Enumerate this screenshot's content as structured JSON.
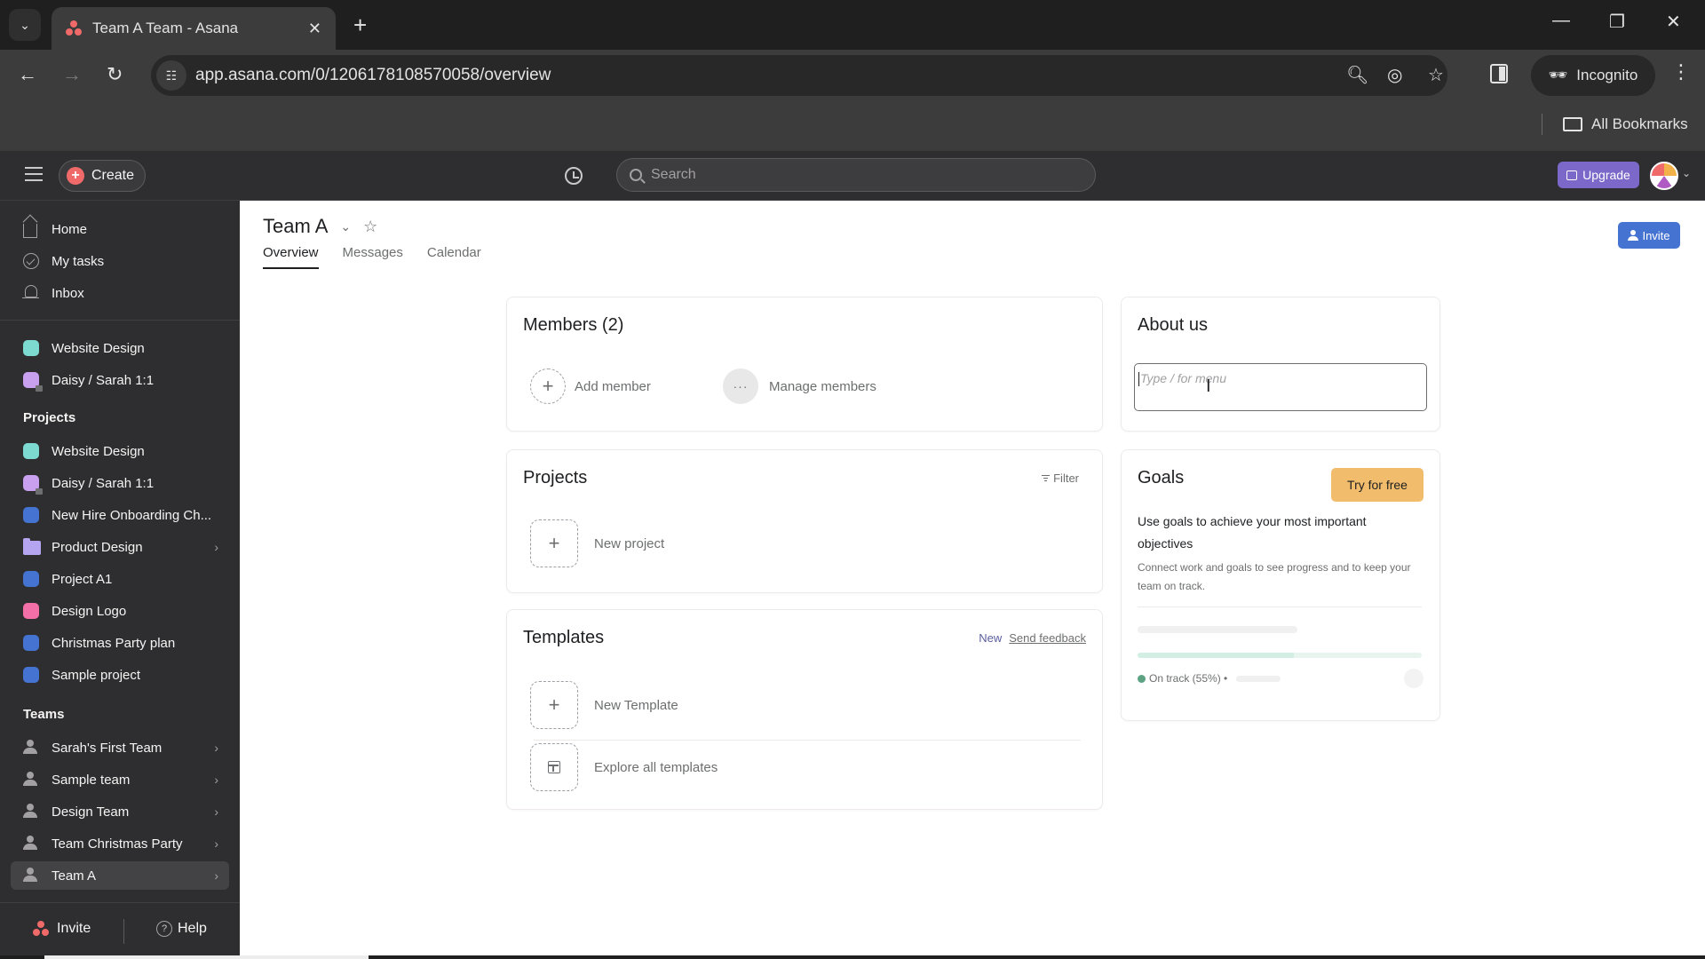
{
  "browser": {
    "tab_title": "Team A Team - Asana",
    "url": "app.asana.com/0/1206178108570058/overview",
    "incognito_label": "Incognito",
    "bookmarks_label": "All Bookmarks"
  },
  "topbar": {
    "create_label": "Create",
    "search_placeholder": "Search",
    "upgrade_label": "Upgrade"
  },
  "sidebar": {
    "nav": [
      {
        "label": "Home",
        "icon": "home-icon"
      },
      {
        "label": "My tasks",
        "icon": "check-circle-icon"
      },
      {
        "label": "Inbox",
        "icon": "bell-icon"
      }
    ],
    "favorites": [
      {
        "label": "Website Design",
        "color": "#7ddad0"
      },
      {
        "label": "Daisy / Sarah 1:1",
        "color": "#c9a0f0",
        "locked": true
      }
    ],
    "projects_heading": "Projects",
    "projects": [
      {
        "label": "Website Design",
        "color": "#7ddad0"
      },
      {
        "label": "Daisy / Sarah 1:1",
        "color": "#c9a0f0",
        "locked": true
      },
      {
        "label": "New Hire Onboarding Ch...",
        "color": "#4573d2"
      },
      {
        "label": "Product Design",
        "color": "#b5a4f0",
        "folder": true
      },
      {
        "label": "Project A1",
        "color": "#4573d2"
      },
      {
        "label": "Design Logo",
        "color": "#f26fa8"
      },
      {
        "label": "Christmas Party plan",
        "color": "#4573d2"
      },
      {
        "label": "Sample project",
        "color": "#4573d2"
      }
    ],
    "teams_heading": "Teams",
    "teams": [
      {
        "label": "Sarah's First Team"
      },
      {
        "label": "Sample team"
      },
      {
        "label": "Design Team"
      },
      {
        "label": "Team Christmas Party"
      },
      {
        "label": "Team A",
        "active": true
      }
    ],
    "footer": {
      "invite_label": "Invite",
      "help_label": "Help"
    }
  },
  "main": {
    "title": "Team A",
    "tabs": [
      {
        "label": "Overview",
        "active": true
      },
      {
        "label": "Messages"
      },
      {
        "label": "Calendar"
      }
    ],
    "invite_label": "Invite",
    "members": {
      "title": "Members (2)",
      "add_label": "Add member",
      "manage_label": "Manage members"
    },
    "projects": {
      "title": "Projects",
      "filter_label": "Filter",
      "new_label": "New project"
    },
    "templates": {
      "title": "Templates",
      "new_badge": "New",
      "feedback_label": "Send feedback",
      "new_template_label": "New Template",
      "explore_label": "Explore all templates"
    },
    "about": {
      "title": "About us",
      "placeholder": "Type / for menu"
    },
    "goals": {
      "title": "Goals",
      "try_label": "Try for free",
      "lead": "Use goals to achieve your most important objectives",
      "sub": "Connect work and goals to see progress and to keep your team on track.",
      "status": "On track (55%) •",
      "progress_percent": 55
    }
  },
  "colors": {
    "accent_blue": "#4573d2",
    "upgrade_purple": "#7b68c9",
    "try_orange": "#f1bd6c",
    "asana_coral": "#f06a6a",
    "on_track_green": "#5da283"
  }
}
